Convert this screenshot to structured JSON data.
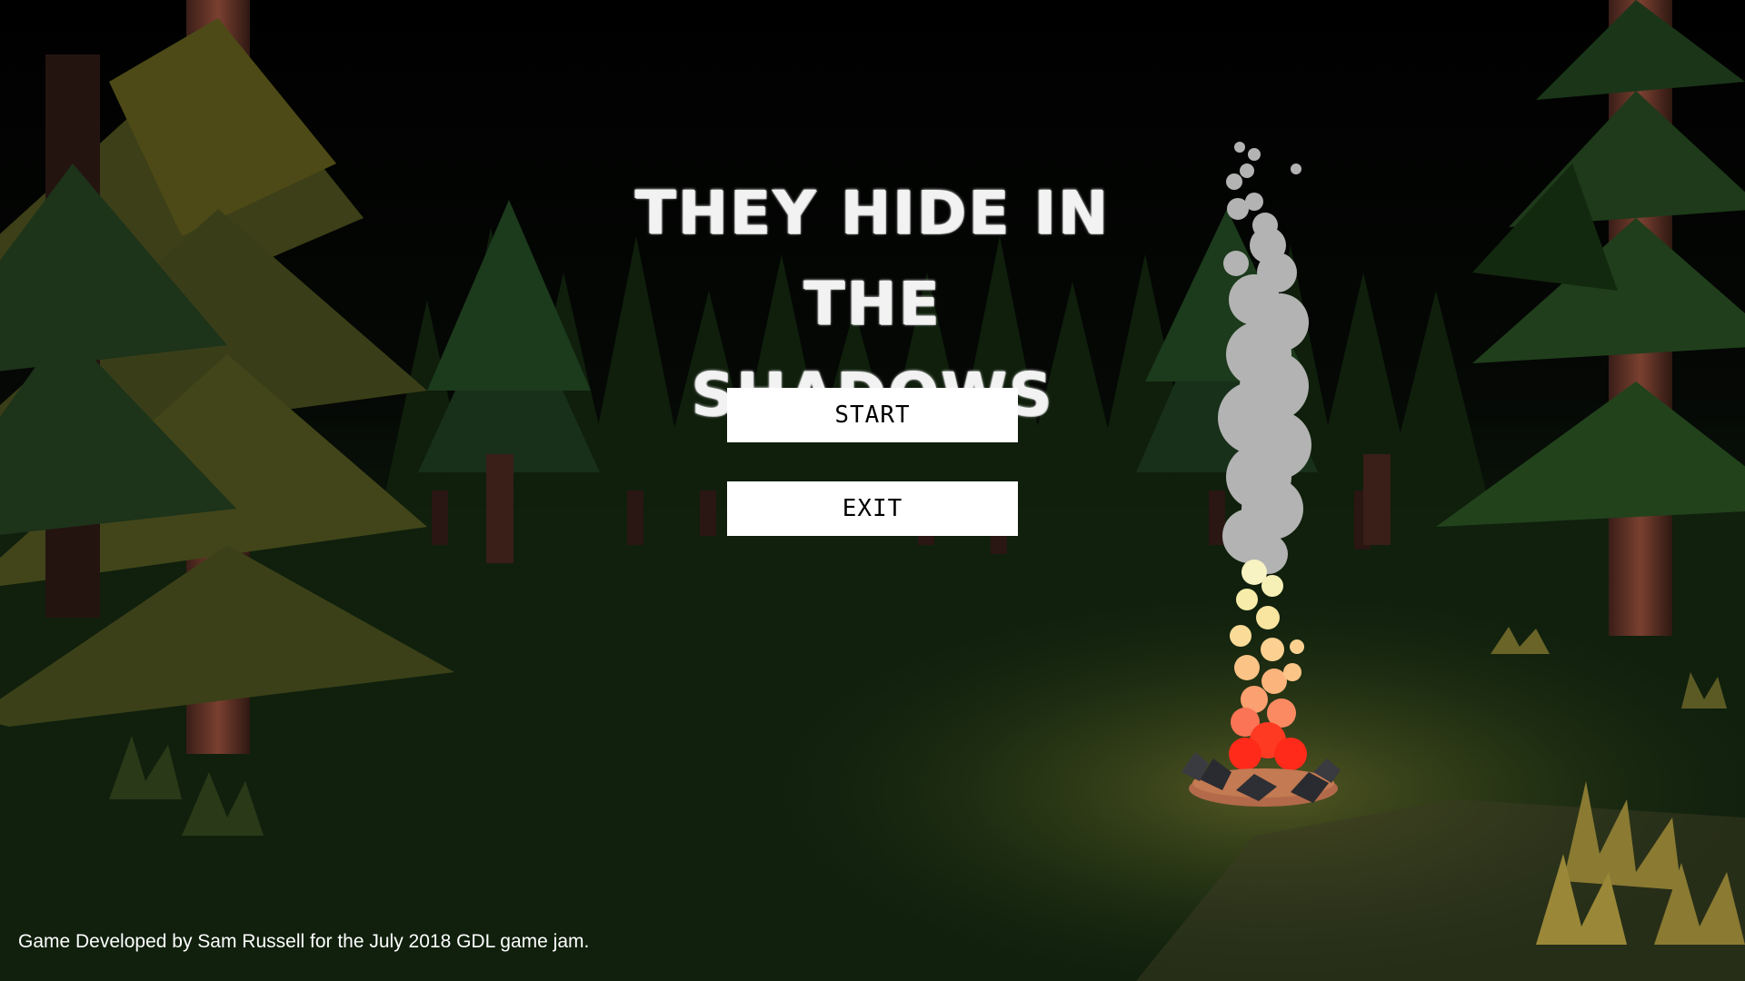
{
  "game": {
    "title_line1": "THEY HIDE IN THE",
    "title_line2": "SHADOWS",
    "credit": "Game Developed by Sam Russell for the July 2018 GDL game jam."
  },
  "menu": {
    "start_label": "START",
    "exit_label": "EXIT"
  },
  "colors": {
    "sky": "#000000",
    "ground": "#172c12",
    "tree_foliage": "#2b4a1e",
    "tree_trunk": "#5a2e22",
    "smoke": "#b0b0b0",
    "fire": "#ff2a1a",
    "button_bg": "#ffffff",
    "button_text": "#000000"
  }
}
